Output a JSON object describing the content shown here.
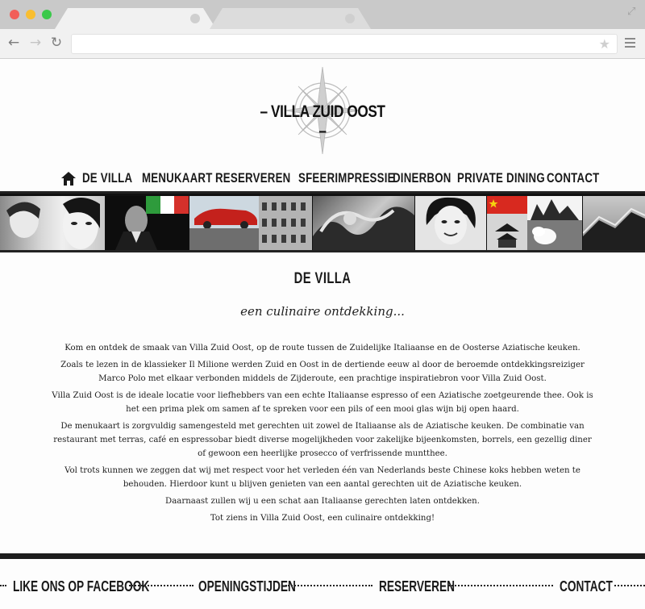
{
  "browser": {
    "address": "",
    "star_glyph": "★",
    "back_glyph": "←",
    "forward_glyph": "→",
    "reload_glyph": "↻",
    "expand_glyph": "⤢"
  },
  "logo": {
    "title": "– VILLA ZUID OOST –"
  },
  "nav": {
    "items": [
      {
        "label": "DE VILLA"
      },
      {
        "label": "MENUKAART"
      },
      {
        "label": "RESERVEREN"
      },
      {
        "label": "SFEERIMPRESSIE"
      },
      {
        "label": "DINERBON"
      },
      {
        "label": "PRIVATE DINING"
      },
      {
        "label": "CONTACT"
      }
    ]
  },
  "content": {
    "heading": "DE VILLA",
    "subtitle": "een culinaire ontdekking...",
    "paragraphs": [
      "Kom en ontdek de smaak van Villa Zuid Oost, op de route tussen de Zuidelijke Italiaanse en de Oosterse Aziatische keuken.",
      "Zoals te lezen in de klassieker Il Milione werden Zuid en Oost in de dertiende eeuw al door de beroemde ontdekkingsreiziger Marco Polo met elkaar verbonden middels de Zijderoute, een prachtige inspiratiebron voor Villa Zuid Oost.",
      "Villa Zuid Oost is de ideale locatie voor liefhebbers van een echte Italiaanse espresso of een Aziatische zoetgeurende thee. Ook is het een prima plek om samen af te spreken voor een pils of een mooi glas wijn bij open haard.",
      "De menukaart is zorgvuldig samengesteld met gerechten uit zowel de Italiaanse als de Aziatische keuken. De combinatie van restaurant met terras, café en espressobar biedt diverse mogelijkheden voor zakelijke bijeenkomsten, borrels, een gezellig diner of gewoon een heerlijke prosecco of verfrissende muntthee.",
      "Vol trots kunnen we zeggen dat wij met respect voor het verleden één van Nederlands beste Chinese koks hebben weten te behouden. Hierdoor kunt u blijven genieten van een aantal gerechten uit de Aziatische keuken.",
      "Daarnaast zullen wij u een schat aan Italiaanse gerechten laten ontdekken.",
      "Tot ziens in Villa Zuid Oost, een culinaire ontdekking!"
    ]
  },
  "footer": {
    "items": [
      {
        "label": "LIKE ONS OP FACEBOOK"
      },
      {
        "label": "OPENINGSTIJDEN"
      },
      {
        "label": "RESERVEREN"
      },
      {
        "label": "CONTACT"
      }
    ]
  },
  "colors": {
    "accent": "#1a1a1a",
    "italy_green": "#2e9b3c",
    "italy_red": "#d5312b",
    "china_red": "#d8291f",
    "china_star": "#f5d10f",
    "car_red": "#c4211c"
  }
}
